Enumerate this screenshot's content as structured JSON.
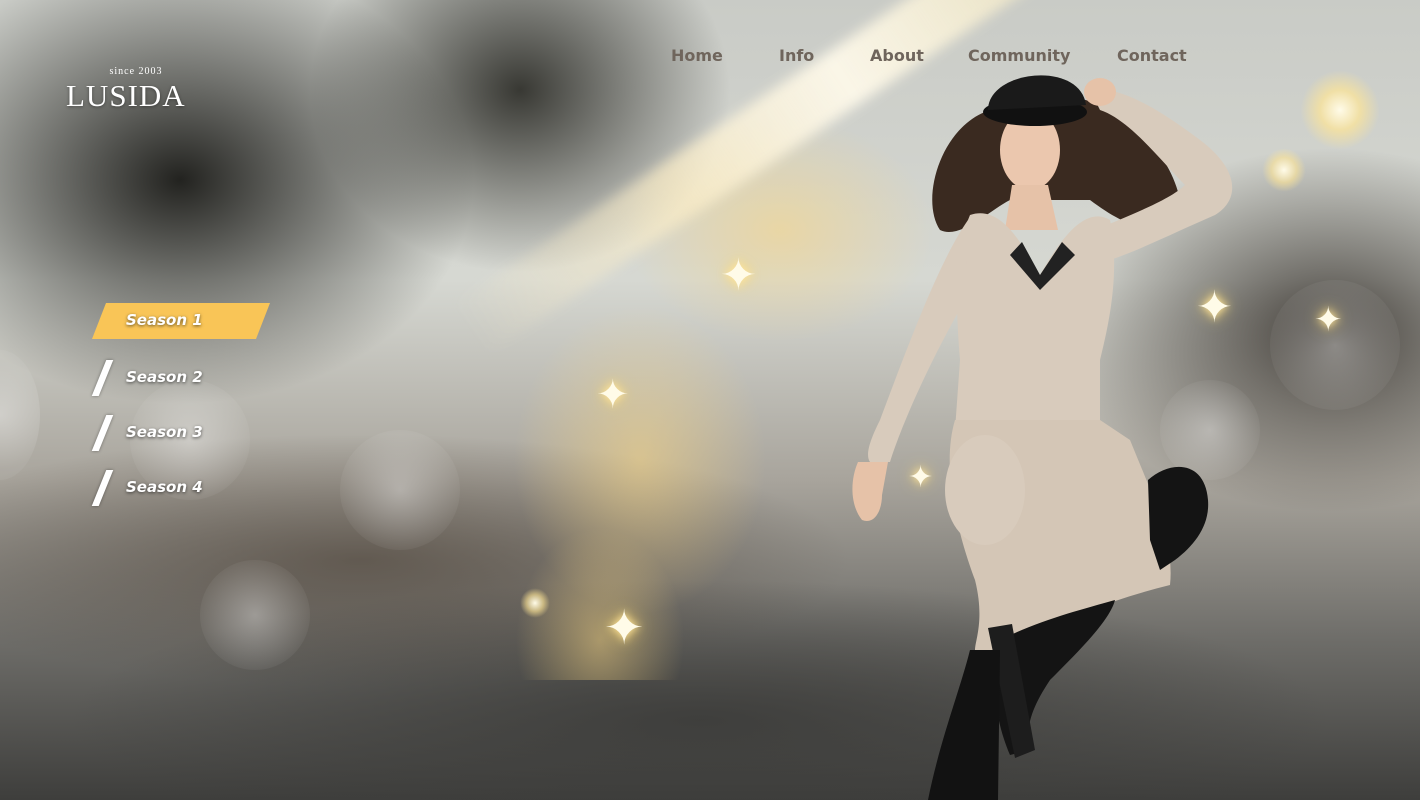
{
  "brand": {
    "tagline": "since 2003",
    "name": "LUSIDA"
  },
  "nav": {
    "items": [
      {
        "label": "Home"
      },
      {
        "label": "Info"
      },
      {
        "label": "About"
      },
      {
        "label": "Community"
      },
      {
        "label": "Contact"
      }
    ]
  },
  "seasons": {
    "active_index": 0,
    "items": [
      {
        "label": "Season 1"
      },
      {
        "label": "Season 2"
      },
      {
        "label": "Season 3"
      },
      {
        "label": "Season 4"
      }
    ]
  },
  "hero": {
    "image": "model-in-beige-dress-jumping-with-golden-sparkles"
  },
  "colors": {
    "accent": "#f9c557",
    "nav_text": "#6f655c",
    "text_light": "#ffffff"
  }
}
